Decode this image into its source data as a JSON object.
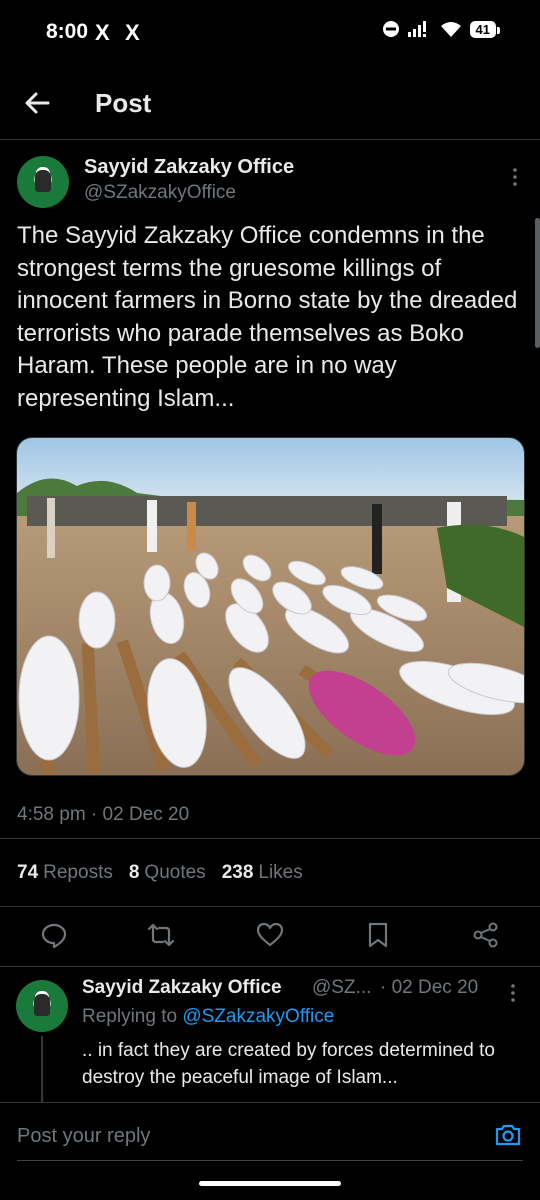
{
  "status_bar": {
    "time": "8:00",
    "x_icon_1": "X",
    "x_icon_2": "X",
    "battery": "41"
  },
  "header": {
    "title": "Post"
  },
  "post": {
    "author_name": "Sayyid Zakzaky Office",
    "author_handle": "@SZakzakyOffice",
    "text": "The Sayyid Zakzaky Office condemns in the strongest terms the gruesome killings of innocent farmers in Borno state by the dreaded terrorists who parade themselves as Boko Haram.  These people are in no way representing Islam...",
    "timestamp": "4:58 pm · 02 Dec 20",
    "stats": {
      "reposts_count": "74",
      "reposts_label": "Reposts",
      "quotes_count": "8",
      "quotes_label": "Quotes",
      "likes_count": "238",
      "likes_label": "Likes"
    }
  },
  "reply": {
    "author_name": "Sayyid Zakzaky Office",
    "author_handle": "@SZ...",
    "date": "· 02 Dec 20",
    "replying_prefix": "Replying to",
    "replying_to": "@SZakzakyOffice",
    "text": ".. in fact they are created by forces determined to destroy the peaceful image of Islam..."
  },
  "composer": {
    "placeholder": "Post your reply"
  },
  "icons": {
    "back": "arrow-left-icon",
    "more": "more-vertical-icon",
    "reply": "comment-icon",
    "repost": "repost-icon",
    "like": "heart-icon",
    "bookmark": "bookmark-icon",
    "share": "share-icon",
    "camera": "camera-icon"
  },
  "colors": {
    "background": "#000000",
    "text": "#e7e9ea",
    "secondary": "#71767b",
    "accent": "#1d9bf0",
    "border": "#2f3336"
  }
}
